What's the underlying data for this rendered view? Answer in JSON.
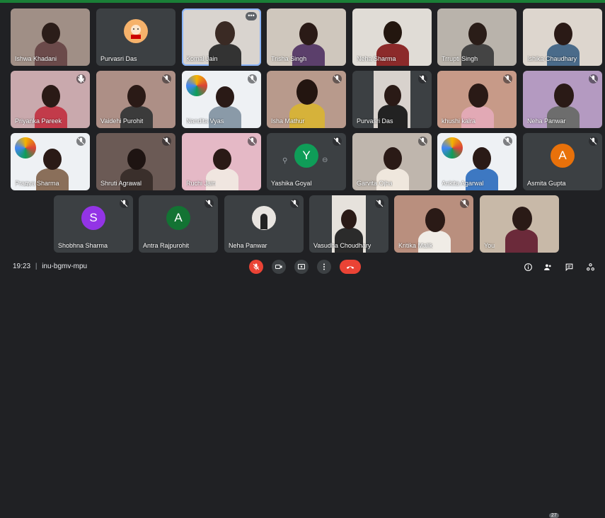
{
  "meeting": {
    "time": "19:23",
    "separator": "|",
    "code": "inu-bgmv-mpu"
  },
  "participants_badge": "27",
  "colors": {
    "background": "#202124",
    "tile": "#3c4043",
    "danger": "#ea4335",
    "accent_purple": "#9334e6",
    "accent_green": "#137333",
    "accent_orange": "#e8710a"
  },
  "tiles": [
    {
      "name": "Ishwa Khadani"
    },
    {
      "name": "Purvasri Das"
    },
    {
      "name": "Komal Jain"
    },
    {
      "name": "Trisha Singh"
    },
    {
      "name": "Neha Sharma"
    },
    {
      "name": "Trrupti Singh"
    },
    {
      "name": "Ishika Chaudhary"
    },
    {
      "name": "Priyanka Pareek"
    },
    {
      "name": "Vaidehi Purohit"
    },
    {
      "name": "Nandita Vyas"
    },
    {
      "name": "Isha Mathur"
    },
    {
      "name": "Purvasri Das"
    },
    {
      "name": "khushi kalra"
    },
    {
      "name": "Neha Panwar"
    },
    {
      "name": "Pragya Sharma"
    },
    {
      "name": "Shruti Agrawal"
    },
    {
      "name": "Ruchi Jain"
    },
    {
      "name": "Yashika Goyal",
      "avatar": "Y"
    },
    {
      "name": "Garvita Ojha"
    },
    {
      "name": "Ankita Agarwal"
    },
    {
      "name": "Asmita Gupta",
      "avatar": "A"
    },
    {
      "name": "Shobhna Sharma",
      "avatar": "S"
    },
    {
      "name": "Antra Rajpurohit",
      "avatar": "A"
    },
    {
      "name": "Neha Panwar"
    },
    {
      "name": "Vasudha Choudhary"
    },
    {
      "name": "Kritika Malik"
    },
    {
      "name": "You"
    }
  ],
  "icons": {
    "mic_off": "mic-off-icon",
    "camera": "camera-icon",
    "present": "present-icon",
    "more": "more-options-icon",
    "end_call": "end-call-icon",
    "info": "info-icon",
    "people": "people-icon",
    "chat": "chat-icon",
    "activities": "activities-icon"
  }
}
